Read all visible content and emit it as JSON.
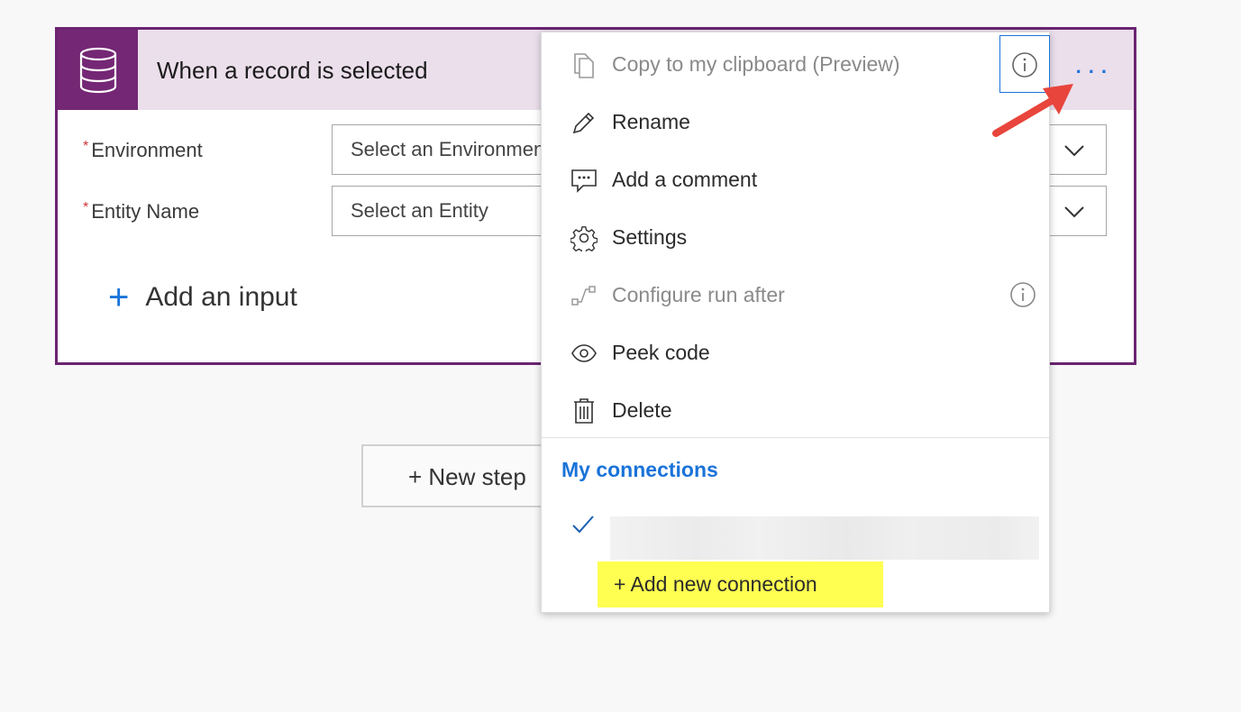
{
  "card": {
    "title": "When a record is selected",
    "icon": "database-icon",
    "more": "...",
    "fields": [
      {
        "required": "*",
        "label": "Environment",
        "placeholder": "Select an Environment"
      },
      {
        "required": "*",
        "label": "Entity Name",
        "placeholder": "Select an Entity"
      }
    ],
    "add_input_plus": "+",
    "add_input_label": "Add an input"
  },
  "new_step": {
    "label": "+ New step"
  },
  "menu": {
    "items": [
      {
        "label": "Copy to my clipboard (Preview)",
        "icon": "copy-icon",
        "disabled": true,
        "info": true
      },
      {
        "label": "Rename",
        "icon": "pencil-icon",
        "disabled": false
      },
      {
        "label": "Add a comment",
        "icon": "comment-icon",
        "disabled": false
      },
      {
        "label": "Settings",
        "icon": "gear-icon",
        "disabled": false
      },
      {
        "label": "Configure run after",
        "icon": "run-after-icon",
        "disabled": true,
        "info": true
      },
      {
        "label": "Peek code",
        "icon": "eye-icon",
        "disabled": false
      },
      {
        "label": "Delete",
        "icon": "trash-icon",
        "disabled": false
      }
    ],
    "connections_title": "My connections",
    "add_connection_label": "+ Add new connection"
  },
  "colors": {
    "accent": "#742774",
    "header_bg": "#ebdfeb",
    "link": "#1a73d9",
    "highlight": "#ffff52",
    "arrow": "#e8453c"
  }
}
